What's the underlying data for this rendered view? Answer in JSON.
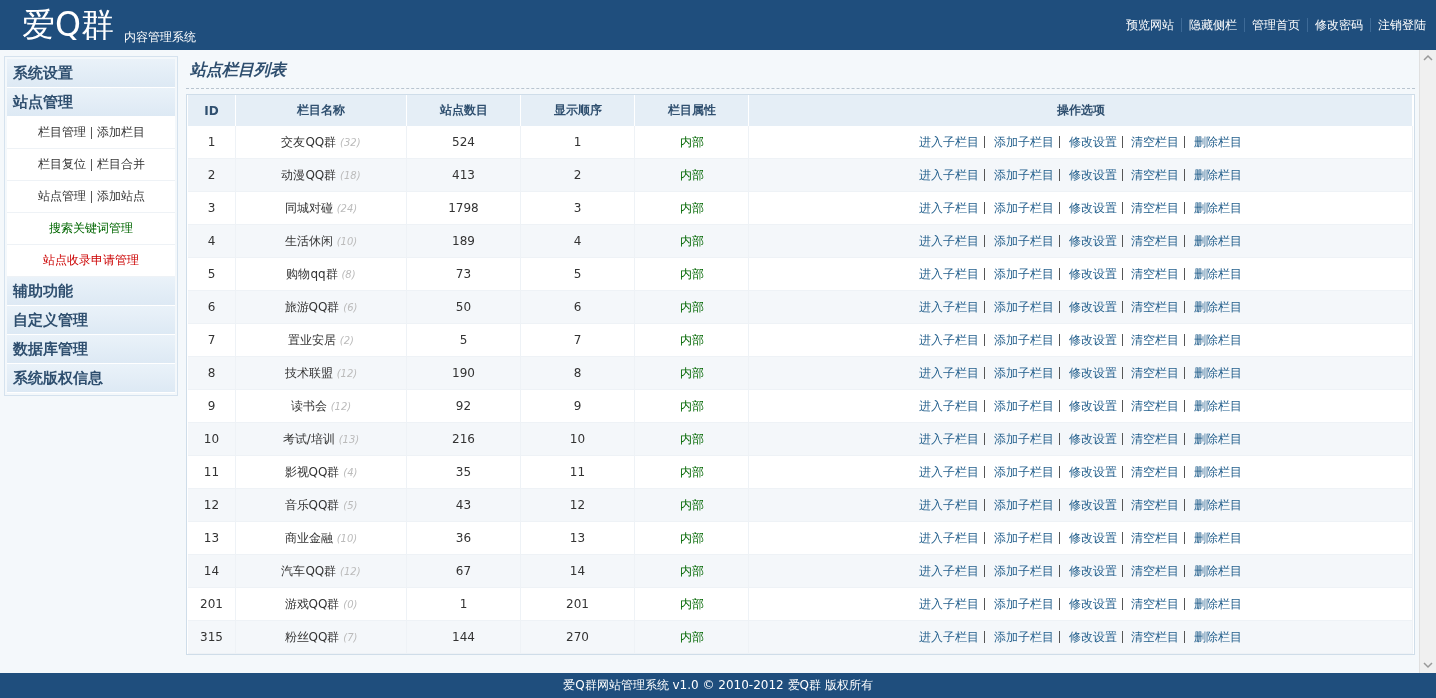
{
  "header": {
    "logo": "爱Q群",
    "subtitle": "内容管理系统",
    "links": [
      "预览网站",
      "隐藏侧栏",
      "管理首页",
      "修改密码",
      "注销登陆"
    ]
  },
  "sidebar": [
    {
      "title": "系统设置"
    },
    {
      "title": "站点管理",
      "items": [
        {
          "links": [
            "栏目管理",
            "添加栏目"
          ],
          "kind": "normal"
        },
        {
          "links": [
            "栏目复位",
            "栏目合并"
          ],
          "kind": "normal"
        },
        {
          "links": [
            "站点管理",
            "添加站点"
          ],
          "kind": "normal"
        },
        {
          "links": [
            "搜索关键词管理"
          ],
          "kind": "keyword"
        },
        {
          "links": [
            "站点收录申请管理"
          ],
          "kind": "alert"
        }
      ]
    },
    {
      "title": "辅助功能"
    },
    {
      "title": "自定义管理"
    },
    {
      "title": "数据库管理"
    },
    {
      "title": "系统版权信息"
    }
  ],
  "page_title": "站点栏目列表",
  "table": {
    "columns": [
      "ID",
      "栏目名称",
      "站点数目",
      "显示顺序",
      "栏目属性",
      "操作选项"
    ],
    "rows": [
      {
        "id": "1",
        "name": "交友QQ群",
        "count_note": "(32)",
        "sites": "524",
        "order": "1",
        "attr": "内部",
        "actions": [
          "进入子栏目",
          "添加子栏目",
          "修改设置",
          "清空栏目",
          "删除栏目"
        ]
      },
      {
        "id": "2",
        "name": "动漫QQ群",
        "count_note": "(18)",
        "sites": "413",
        "order": "2",
        "attr": "内部",
        "actions": [
          "进入子栏目",
          "添加子栏目",
          "修改设置",
          "清空栏目",
          "删除栏目"
        ]
      },
      {
        "id": "3",
        "name": "同城对碰",
        "count_note": "(24)",
        "sites": "1798",
        "order": "3",
        "attr": "内部",
        "actions": [
          "进入子栏目",
          "添加子栏目",
          "修改设置",
          "清空栏目",
          "删除栏目"
        ]
      },
      {
        "id": "4",
        "name": "生活休闲",
        "count_note": "(10)",
        "sites": "189",
        "order": "4",
        "attr": "内部",
        "actions": [
          "进入子栏目",
          "添加子栏目",
          "修改设置",
          "清空栏目",
          "删除栏目"
        ]
      },
      {
        "id": "5",
        "name": "购物qq群",
        "count_note": "(8)",
        "sites": "73",
        "order": "5",
        "attr": "内部",
        "actions": [
          "进入子栏目",
          "添加子栏目",
          "修改设置",
          "清空栏目",
          "删除栏目"
        ]
      },
      {
        "id": "6",
        "name": "旅游QQ群",
        "count_note": "(6)",
        "sites": "50",
        "order": "6",
        "attr": "内部",
        "actions": [
          "进入子栏目",
          "添加子栏目",
          "修改设置",
          "清空栏目",
          "删除栏目"
        ]
      },
      {
        "id": "7",
        "name": "置业安居",
        "count_note": "(2)",
        "sites": "5",
        "order": "7",
        "attr": "内部",
        "actions": [
          "进入子栏目",
          "添加子栏目",
          "修改设置",
          "清空栏目",
          "删除栏目"
        ]
      },
      {
        "id": "8",
        "name": "技术联盟",
        "count_note": "(12)",
        "sites": "190",
        "order": "8",
        "attr": "内部",
        "actions": [
          "进入子栏目",
          "添加子栏目",
          "修改设置",
          "清空栏目",
          "删除栏目"
        ]
      },
      {
        "id": "9",
        "name": "读书会",
        "count_note": "(12)",
        "sites": "92",
        "order": "9",
        "attr": "内部",
        "actions": [
          "进入子栏目",
          "添加子栏目",
          "修改设置",
          "清空栏目",
          "删除栏目"
        ]
      },
      {
        "id": "10",
        "name": "考试/培训",
        "count_note": "(13)",
        "sites": "216",
        "order": "10",
        "attr": "内部",
        "actions": [
          "进入子栏目",
          "添加子栏目",
          "修改设置",
          "清空栏目",
          "删除栏目"
        ]
      },
      {
        "id": "11",
        "name": "影视QQ群",
        "count_note": "(4)",
        "sites": "35",
        "order": "11",
        "attr": "内部",
        "actions": [
          "进入子栏目",
          "添加子栏目",
          "修改设置",
          "清空栏目",
          "删除栏目"
        ]
      },
      {
        "id": "12",
        "name": "音乐QQ群",
        "count_note": "(5)",
        "sites": "43",
        "order": "12",
        "attr": "内部",
        "actions": [
          "进入子栏目",
          "添加子栏目",
          "修改设置",
          "清空栏目",
          "删除栏目"
        ]
      },
      {
        "id": "13",
        "name": "商业金融",
        "count_note": "(10)",
        "sites": "36",
        "order": "13",
        "attr": "内部",
        "actions": [
          "进入子栏目",
          "添加子栏目",
          "修改设置",
          "清空栏目",
          "删除栏目"
        ]
      },
      {
        "id": "14",
        "name": "汽车QQ群",
        "count_note": "(12)",
        "sites": "67",
        "order": "14",
        "attr": "内部",
        "actions": [
          "进入子栏目",
          "添加子栏目",
          "修改设置",
          "清空栏目",
          "删除栏目"
        ]
      },
      {
        "id": "201",
        "name": "游戏QQ群",
        "count_note": "(0)",
        "sites": "1",
        "order": "201",
        "attr": "内部",
        "actions": [
          "进入子栏目",
          "添加子栏目",
          "修改设置",
          "清空栏目",
          "删除栏目"
        ]
      },
      {
        "id": "315",
        "name": "粉丝QQ群",
        "count_note": "(7)",
        "sites": "144",
        "order": "270",
        "attr": "内部",
        "actions": [
          "进入子栏目",
          "添加子栏目",
          "修改设置",
          "清空栏目",
          "删除栏目"
        ]
      }
    ]
  },
  "footer": "爱Q群网站管理系统 v1.0 © 2010-2012 爱Q群 版权所有"
}
